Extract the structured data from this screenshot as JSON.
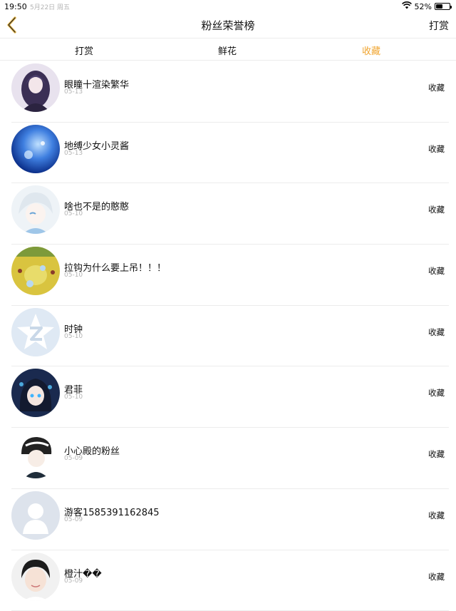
{
  "status_bar": {
    "time": "19:50",
    "date": "5月22日 周五",
    "battery": "52%",
    "battery_level": 0.52,
    "icons": [
      "wifi-icon",
      "battery-icon"
    ]
  },
  "nav": {
    "title": "粉丝荣誉榜",
    "action": "打赏",
    "back_icon": "chevron-left-icon",
    "accent": "#f0a530"
  },
  "tabs": [
    {
      "label": "打赏",
      "active": false
    },
    {
      "label": "鲜花",
      "active": false
    },
    {
      "label": "收藏",
      "active": true
    }
  ],
  "fans": [
    {
      "name": "眼瞳十渲染繁华",
      "date": "05-13",
      "action": "收藏",
      "avatar": "anime-girl-purple"
    },
    {
      "name": "地缚少女小灵酱",
      "date": "05-13",
      "action": "收藏",
      "avatar": "blue-sky"
    },
    {
      "name": "啥也不是的憨憨",
      "date": "05-10",
      "action": "收藏",
      "avatar": "white-hair-anime"
    },
    {
      "name": "拉钩为什么要上吊！！！",
      "date": "05-10",
      "action": "收藏",
      "avatar": "yellow-game"
    },
    {
      "name": "时钟",
      "date": "05-10",
      "action": "收藏",
      "avatar": "default-star"
    },
    {
      "name": "君菲",
      "date": "05-10",
      "action": "收藏",
      "avatar": "anime-dark-blue"
    },
    {
      "name": "小心殿的粉丝",
      "date": "05-09",
      "action": "收藏",
      "avatar": "anime-helmet"
    },
    {
      "name": "游客1585391162845",
      "date": "05-09",
      "action": "收藏",
      "avatar": "default-person"
    },
    {
      "name": "橙汁��",
      "date": "05-09",
      "action": "收藏",
      "avatar": "boy-photo"
    }
  ]
}
